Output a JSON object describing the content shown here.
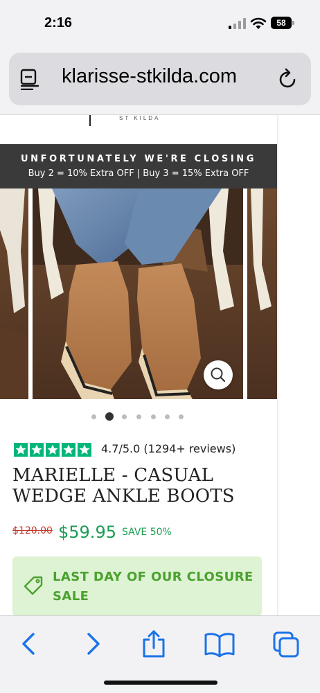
{
  "status_bar": {
    "time": "2:16",
    "battery": "58",
    "icons": [
      "cellular-signal-icon",
      "wifi-icon",
      "battery-icon"
    ]
  },
  "browser": {
    "url": "klarisse-stkilda.com",
    "icons": [
      "reader-mode-icon",
      "reload-icon"
    ],
    "toolbar": [
      "back-icon",
      "forward-icon",
      "share-icon",
      "bookmarks-icon",
      "tabs-icon"
    ]
  },
  "site": {
    "logo_text": "ST KILDA"
  },
  "banner": {
    "headline": "UNFORTUNATELY WE'RE CLOSING",
    "offer": "Buy 2 = 10% Extra OFF | Buy 3 = 15% Extra OFF"
  },
  "gallery": {
    "total_images": 7,
    "active_index": 2,
    "zoom_icon": "magnifier-icon"
  },
  "product": {
    "rating_stars": 5,
    "rating_text": "4.7/5.0 (1294+ reviews)",
    "title": "MARIELLE - CASUAL WEDGE ANKLE BOOTS",
    "original_price": "$120.00",
    "sale_price": "$59.95",
    "save_label": "SAVE 50%"
  },
  "promo": {
    "text": "LAST DAY OF OUR CLOSURE SALE",
    "icon": "price-tag-icon"
  },
  "colors": {
    "accent_green": "#1a9d52",
    "star_green": "#00b67a",
    "banner_bg": "#3a3a3a",
    "promo_bg": "#ddf3d3",
    "strike_red": "#c0392b",
    "ios_blue": "#1a73e8"
  }
}
